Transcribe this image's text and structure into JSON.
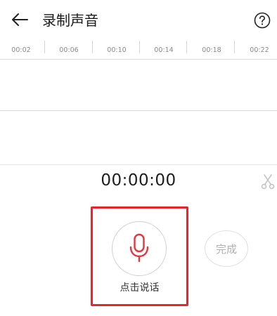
{
  "header": {
    "title": "录制声音"
  },
  "timeline": {
    "ticks": [
      "00:02",
      "00:06",
      "00:10",
      "00:14",
      "00:18",
      "00:22"
    ]
  },
  "recorder": {
    "elapsed": "00:00:00",
    "record_label": "点击说话",
    "done_label": "完成"
  },
  "colors": {
    "accent": "#e8262a",
    "mic_icon": "#e4363c",
    "disabled_text": "#b0b0b0"
  },
  "icons": {
    "back": "back-arrow-icon",
    "help": "question-circle-icon",
    "scissors": "scissors-icon",
    "mic": "microphone-icon"
  }
}
